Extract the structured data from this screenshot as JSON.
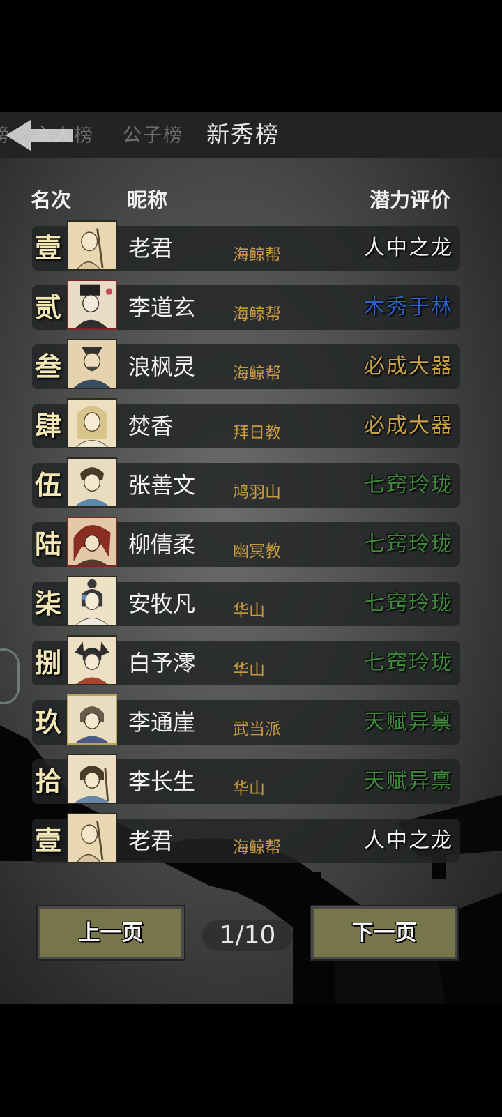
{
  "tabs": [
    {
      "label": "榜"
    },
    {
      "label": "主人榜"
    },
    {
      "label": "公子榜"
    },
    {
      "label": "新秀榜"
    }
  ],
  "headers": {
    "rank": "名次",
    "name": "昵称",
    "rating": "潜力评价"
  },
  "colors": {
    "white": "#f5f5f5",
    "blue": "#2d63c9",
    "gold": "#c9a247",
    "green": "#3f8a3b"
  },
  "rows": [
    {
      "rank": "壹",
      "name": "老君",
      "sect": "海鲸帮",
      "rating": "人中之龙",
      "color": "#f5f5f5"
    },
    {
      "rank": "贰",
      "name": "李道玄",
      "sect": "海鲸帮",
      "rating": "木秀于林",
      "color": "#2d63c9"
    },
    {
      "rank": "叁",
      "name": "浪枫灵",
      "sect": "海鲸帮",
      "rating": "必成大器",
      "color": "#c9a247"
    },
    {
      "rank": "肆",
      "name": "焚香",
      "sect": "拜日教",
      "rating": "必成大器",
      "color": "#c9a247"
    },
    {
      "rank": "伍",
      "name": "张善文",
      "sect": "鸠羽山",
      "rating": "七窍玲珑",
      "color": "#3f8a3b"
    },
    {
      "rank": "陆",
      "name": "柳倩柔",
      "sect": "幽冥教",
      "rating": "七窍玲珑",
      "color": "#3f8a3b"
    },
    {
      "rank": "柒",
      "name": "安牧凡",
      "sect": "华山",
      "rating": "七窍玲珑",
      "color": "#3f8a3b"
    },
    {
      "rank": "捌",
      "name": "白予澪",
      "sect": "华山",
      "rating": "七窍玲珑",
      "color": "#3f8a3b"
    },
    {
      "rank": "玖",
      "name": "李通崖",
      "sect": "武当派",
      "rating": "天赋异禀",
      "color": "#3f8a3b"
    },
    {
      "rank": "拾",
      "name": "李长生",
      "sect": "华山",
      "rating": "天赋异禀",
      "color": "#3f8a3b"
    },
    {
      "rank": "壹",
      "name": "老君",
      "sect": "海鲸帮",
      "rating": "人中之龙",
      "color": "#f5f5f5"
    }
  ],
  "pagination": {
    "prev": "上一页",
    "page": "1/10",
    "next": "下一页"
  }
}
